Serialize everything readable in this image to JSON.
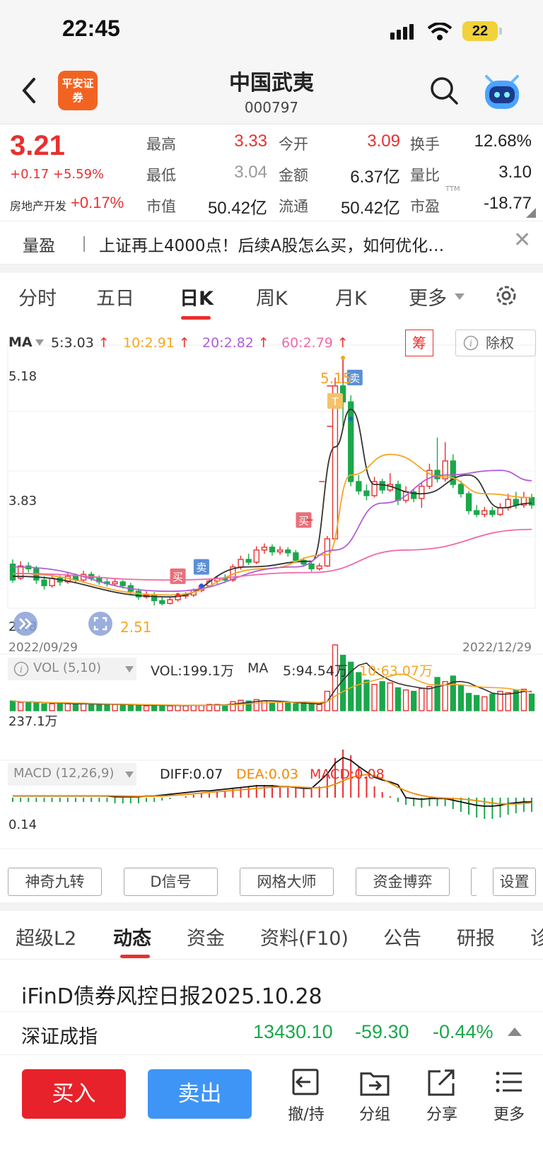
{
  "status_bar": {
    "time": "22:45",
    "battery": "22"
  },
  "header": {
    "stock_name": "中国武夷",
    "stock_code": "000797",
    "broker_logo_text": "平安证券"
  },
  "quote": {
    "price": "3.21",
    "change": "+0.17 +5.59%",
    "sector_name": "房地产开发",
    "sector_change": "+0.17%",
    "fields": [
      {
        "label": "最高",
        "value": "3.33"
      },
      {
        "label": "今开",
        "value": "3.09"
      },
      {
        "label": "换手",
        "value": "12.68%"
      },
      {
        "label": "最低",
        "value": "3.04"
      },
      {
        "label": "金额",
        "value": "6.37亿"
      },
      {
        "label": "量比",
        "value": "3.10"
      },
      {
        "label": "市值",
        "value": "50.42亿"
      },
      {
        "label": "流通",
        "value": "50.42亿"
      },
      {
        "label": "市盈",
        "value": "-18.77"
      }
    ],
    "ttm_label": "TTM"
  },
  "news": {
    "tag": "量盈",
    "text": "上证再上4000点！后续A股怎么买，如何优化…"
  },
  "chart_tabs": [
    "分时",
    "五日",
    "日K",
    "周K",
    "月K",
    "更多"
  ],
  "chart_tabs_active": "日K",
  "ma_bar": {
    "label": "MA",
    "items": [
      {
        "text": "5:3.03",
        "color": "#333333"
      },
      {
        "text": "10:2.91",
        "color": "#f5a623"
      },
      {
        "text": "20:2.82",
        "color": "#b05ed8"
      },
      {
        "text": "60:2.79",
        "color": "#f06aa8"
      }
    ],
    "chip_button": "筹",
    "ex_rights_button": "除权"
  },
  "chart_data": {
    "type": "candlestick",
    "price_axis": {
      "top_label": "5.18",
      "mid_label": "3.83",
      "bottom_label": "2.48",
      "range": [
        2.48,
        5.18
      ]
    },
    "date_start": "2022/09/29",
    "date_end": "2022/12/29",
    "annotations": {
      "high": "5.15",
      "low": "2.51",
      "buy_label": "买",
      "sell_label": "卖",
      "t_label": "T"
    },
    "candles": [
      [
        2.95,
        2.78,
        3.0,
        2.75
      ],
      [
        2.8,
        2.93,
        2.98,
        2.78
      ],
      [
        2.93,
        2.9,
        2.97,
        2.86
      ],
      [
        2.9,
        2.78,
        2.93,
        2.74
      ],
      [
        2.78,
        2.72,
        2.82,
        2.68
      ],
      [
        2.72,
        2.8,
        2.84,
        2.7
      ],
      [
        2.8,
        2.76,
        2.83,
        2.72
      ],
      [
        2.76,
        2.82,
        2.86,
        2.74
      ],
      [
        2.82,
        2.78,
        2.85,
        2.75
      ],
      [
        2.78,
        2.84,
        2.88,
        2.76
      ],
      [
        2.84,
        2.8,
        2.87,
        2.77
      ],
      [
        2.8,
        2.76,
        2.83,
        2.73
      ],
      [
        2.76,
        2.74,
        2.8,
        2.71
      ],
      [
        2.74,
        2.76,
        2.79,
        2.72
      ],
      [
        2.76,
        2.72,
        2.78,
        2.69
      ],
      [
        2.72,
        2.66,
        2.75,
        2.63
      ],
      [
        2.66,
        2.6,
        2.69,
        2.57
      ],
      [
        2.6,
        2.62,
        2.66,
        2.58
      ],
      [
        2.62,
        2.56,
        2.65,
        2.51
      ],
      [
        2.56,
        2.53,
        2.6,
        2.51
      ],
      [
        2.53,
        2.57,
        2.6,
        2.52
      ],
      [
        2.57,
        2.61,
        2.63,
        2.55
      ],
      [
        2.61,
        2.62,
        2.65,
        2.58
      ],
      [
        2.62,
        2.67,
        2.69,
        2.6
      ],
      [
        2.67,
        2.72,
        2.74,
        2.65
      ],
      [
        2.72,
        2.77,
        2.79,
        2.7
      ],
      [
        2.77,
        2.8,
        2.82,
        2.74
      ],
      [
        2.8,
        2.78,
        2.84,
        2.75
      ],
      [
        2.78,
        2.92,
        2.95,
        2.76
      ],
      [
        2.92,
        3.0,
        3.04,
        2.89
      ],
      [
        3.0,
        2.97,
        3.06,
        2.94
      ],
      [
        2.97,
        3.1,
        3.14,
        2.95
      ],
      [
        3.1,
        3.13,
        3.17,
        3.06
      ],
      [
        3.13,
        3.08,
        3.16,
        3.04
      ],
      [
        3.08,
        3.1,
        3.14,
        3.05
      ],
      [
        3.1,
        3.07,
        3.13,
        3.03
      ],
      [
        3.07,
        2.99,
        3.1,
        2.96
      ],
      [
        2.99,
        2.95,
        3.02,
        2.92
      ],
      [
        2.95,
        2.9,
        2.98,
        2.87
      ],
      [
        2.9,
        2.93,
        2.96,
        2.88
      ],
      [
        2.93,
        3.22,
        3.25,
        2.92
      ],
      [
        3.22,
        4.85,
        4.94,
        3.2
      ],
      [
        4.85,
        4.68,
        5.15,
        4.42
      ],
      [
        4.68,
        3.83,
        4.75,
        3.78
      ],
      [
        3.83,
        3.73,
        3.9,
        3.69
      ],
      [
        3.73,
        3.68,
        3.8,
        3.63
      ],
      [
        3.68,
        3.83,
        3.88,
        3.66
      ],
      [
        3.83,
        3.74,
        3.86,
        3.7
      ],
      [
        3.74,
        3.8,
        3.92,
        3.72
      ],
      [
        3.8,
        3.63,
        3.84,
        3.58
      ],
      [
        3.63,
        3.72,
        3.78,
        3.6
      ],
      [
        3.72,
        3.65,
        3.75,
        3.61
      ],
      [
        3.65,
        3.78,
        3.82,
        3.55
      ],
      [
        3.78,
        3.95,
        4.02,
        3.75
      ],
      [
        3.95,
        3.86,
        4.3,
        3.82
      ],
      [
        3.86,
        4.05,
        4.25,
        3.83
      ],
      [
        4.05,
        3.8,
        4.12,
        3.76
      ],
      [
        3.8,
        3.7,
        3.84,
        3.66
      ],
      [
        3.7,
        3.52,
        3.73,
        3.48
      ],
      [
        3.52,
        3.48,
        3.58,
        3.45
      ],
      [
        3.48,
        3.52,
        3.56,
        3.45
      ],
      [
        3.52,
        3.48,
        3.56,
        3.45
      ],
      [
        3.48,
        3.55,
        3.6,
        3.46
      ],
      [
        3.55,
        3.64,
        3.7,
        3.52
      ],
      [
        3.64,
        3.58,
        3.72,
        3.54
      ],
      [
        3.58,
        3.66,
        3.72,
        3.55
      ],
      [
        3.66,
        3.58,
        3.7,
        3.54
      ]
    ],
    "ma_lines": [
      {
        "name": "MA5",
        "color": "#333333",
        "points": [
          [
            0,
            2.82
          ],
          [
            20,
            2.6
          ],
          [
            30,
            2.92
          ],
          [
            38,
            2.98
          ],
          [
            41,
            4.2
          ],
          [
            43,
            4.6
          ],
          [
            46,
            3.8
          ],
          [
            52,
            3.7
          ],
          [
            58,
            3.9
          ],
          [
            62,
            3.55
          ],
          [
            66,
            3.6
          ]
        ]
      },
      {
        "name": "MA10",
        "color": "#f5a623",
        "points": [
          [
            0,
            2.85
          ],
          [
            20,
            2.62
          ],
          [
            32,
            2.9
          ],
          [
            40,
            3.05
          ],
          [
            43,
            3.9
          ],
          [
            48,
            4.12
          ],
          [
            55,
            3.88
          ],
          [
            60,
            3.7
          ],
          [
            66,
            3.66
          ]
        ]
      },
      {
        "name": "MA20",
        "color": "#b05ed8",
        "points": [
          [
            0,
            2.92
          ],
          [
            20,
            2.66
          ],
          [
            36,
            2.92
          ],
          [
            41,
            3.1
          ],
          [
            47,
            3.6
          ],
          [
            55,
            3.9
          ],
          [
            62,
            3.95
          ],
          [
            66,
            3.84
          ]
        ]
      },
      {
        "name": "MA60",
        "color": "#f06aa8",
        "points": [
          [
            0,
            2.85
          ],
          [
            20,
            2.78
          ],
          [
            38,
            2.86
          ],
          [
            50,
            3.1
          ],
          [
            66,
            3.32
          ]
        ]
      }
    ]
  },
  "volume_bar": {
    "label": "VOL (5,10)",
    "vol": "VOL:199.1万",
    "ma_label": "MA",
    "ma5": "5:94.54万",
    "ma10": "10:63.07万",
    "axis_label": "237.1万"
  },
  "volume_data": [
    14,
    12,
    13,
    11,
    10,
    10,
    11,
    10,
    9,
    10,
    9,
    9,
    10,
    9,
    8,
    8,
    8,
    7,
    8,
    8,
    7,
    8,
    7,
    8,
    8,
    9,
    9,
    8,
    13,
    15,
    14,
    16,
    14,
    12,
    12,
    11,
    10,
    10,
    9,
    9,
    28,
    95,
    80,
    70,
    55,
    44,
    38,
    42,
    40,
    33,
    30,
    28,
    32,
    35,
    48,
    42,
    50,
    36,
    25,
    22,
    20,
    24,
    28,
    26,
    30,
    31,
    24
  ],
  "macd_bar": {
    "label": "MACD (12,26,9)",
    "diff": "DIFF:0.07",
    "dea": "DEA:0.03",
    "macd": "MACD:0.08",
    "axis_label": "0.14"
  },
  "macd_data": [
    -0.03,
    -0.03,
    -0.03,
    -0.03,
    -0.03,
    -0.03,
    -0.03,
    -0.03,
    -0.03,
    -0.03,
    -0.03,
    -0.03,
    -0.03,
    -0.04,
    -0.04,
    -0.04,
    -0.04,
    -0.03,
    -0.03,
    -0.02,
    -0.01,
    0.0,
    0.01,
    0.02,
    0.03,
    0.03,
    0.04,
    0.05,
    0.06,
    0.07,
    0.08,
    0.09,
    0.09,
    0.09,
    0.08,
    0.08,
    0.07,
    0.06,
    0.06,
    0.08,
    0.16,
    0.28,
    0.34,
    0.3,
    0.22,
    0.15,
    0.08,
    0.04,
    0.01,
    -0.03,
    -0.05,
    -0.06,
    -0.07,
    -0.06,
    -0.06,
    -0.06,
    -0.08,
    -0.1,
    -0.12,
    -0.14,
    -0.15,
    -0.15,
    -0.14,
    -0.12,
    -0.11,
    -0.1,
    -0.1
  ],
  "tools": [
    "神奇九转",
    "D信号",
    "网格大师",
    "资金博弈",
    "设置"
  ],
  "bottom_tabs": [
    "超级L2",
    "动态",
    "资金",
    "资料(F10)",
    "公告",
    "研报",
    "诊"
  ],
  "bottom_tabs_active": "动态",
  "headline": "iFinD债券风控日报2025.10.28",
  "ticker": {
    "name": "深证成指",
    "value": "13430.10",
    "change": "-59.30",
    "pct": "-0.44%"
  },
  "actions": {
    "buy": "买入",
    "sell": "卖出",
    "items": [
      "撤/持",
      "分组",
      "分享",
      "更多"
    ]
  }
}
